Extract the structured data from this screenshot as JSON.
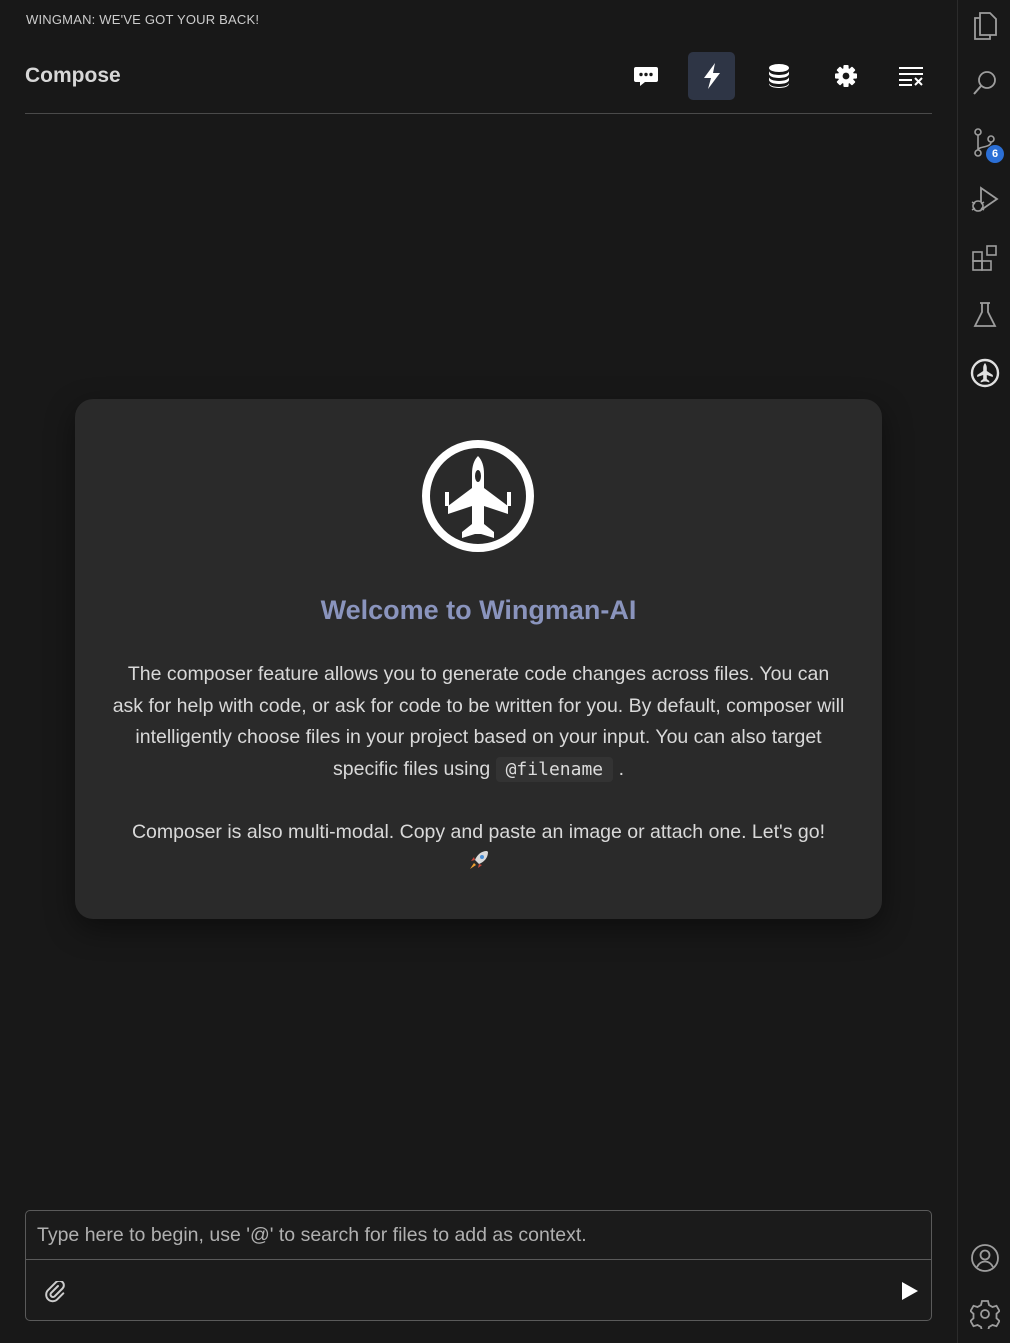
{
  "panel": {
    "title": "WINGMAN: WE'VE GOT YOUR BACK!"
  },
  "header": {
    "title": "Compose",
    "toolbar": [
      {
        "icon": "chat-icon",
        "active": false
      },
      {
        "icon": "lightning-icon",
        "active": true
      },
      {
        "icon": "database-icon",
        "active": false
      },
      {
        "icon": "gear-icon",
        "active": false
      },
      {
        "icon": "clear-list-icon",
        "active": false
      }
    ]
  },
  "welcome": {
    "logo_icon": "jet-fighter-logo-icon",
    "heading": "Welcome to Wingman-AI",
    "description_pre": "The composer feature allows you to generate code changes across files. You can ask for help with code, or ask for code to be written for you. By default, composer will intelligently choose files in your project based on your input. You can also target specific files using",
    "description_code": "@filename",
    "description_post": ".",
    "multimodal": "Composer is also multi-modal. Copy and paste an image or attach one. Let's go!",
    "emoji": "🚀"
  },
  "composer": {
    "placeholder": "Type here to begin, use '@' to search for files to add as context.",
    "attach_icon": "paperclip-icon",
    "send_icon": "send-icon"
  },
  "activity_bar": {
    "items": [
      "explorer-icon",
      "search-icon",
      "source-control-icon",
      "run-debug-icon",
      "extensions-icon",
      "testing-icon",
      "wingman-icon"
    ],
    "source_control_badge": "6",
    "bottom_items": [
      "account-icon",
      "manage-gear-icon"
    ]
  },
  "colors": {
    "background": "#181818",
    "card": "#2a2a2a",
    "heading_start": "#8f97b8",
    "heading_end": "#6f78b5",
    "active_button": "#2e3545",
    "badge": "#2b6fd6"
  }
}
